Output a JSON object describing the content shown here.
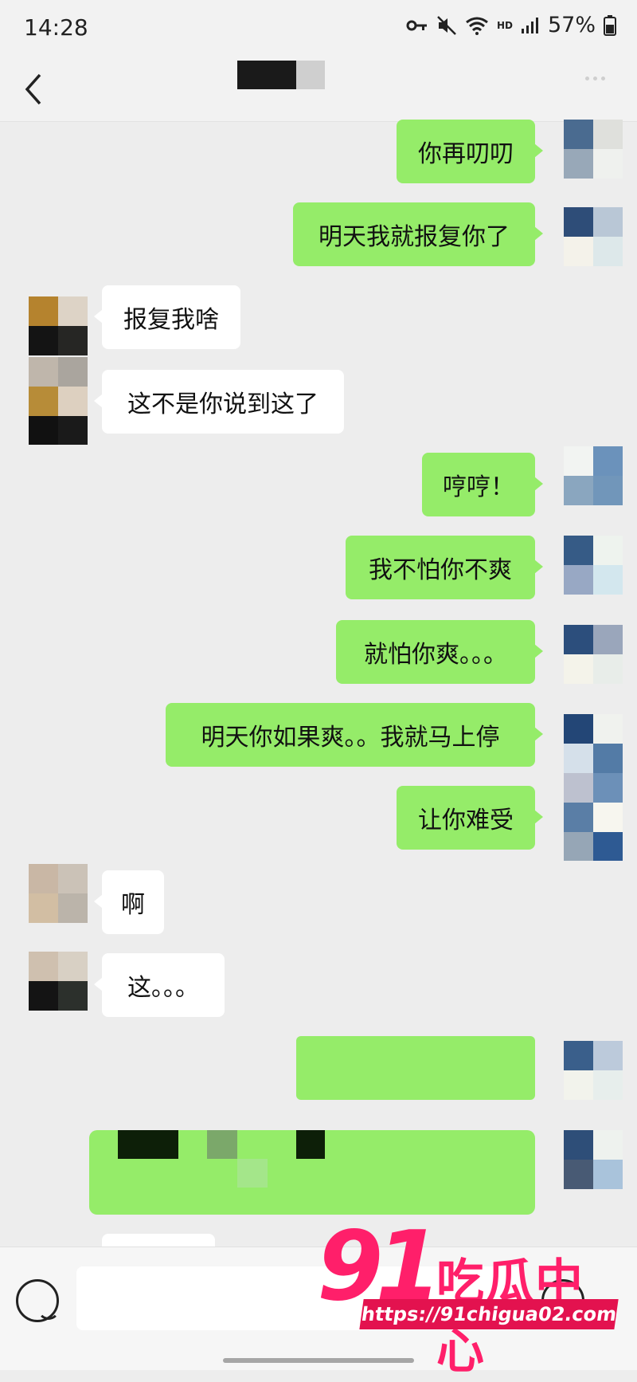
{
  "status_bar": {
    "time": "14:28",
    "hd": "HD",
    "battery": "57%"
  },
  "header": {
    "title_redacted": true
  },
  "messages": [
    {
      "side": "out",
      "text": "你再叨叨"
    },
    {
      "side": "out",
      "text": "明天我就报复你了"
    },
    {
      "side": "in",
      "text": "报复我啥"
    },
    {
      "side": "in",
      "text": "这不是你说到这了"
    },
    {
      "side": "out",
      "text": "哼哼！"
    },
    {
      "side": "out",
      "text": "我不怕你不爽"
    },
    {
      "side": "out",
      "text": "就怕你爽。。。"
    },
    {
      "side": "out",
      "text": "明天你如果爽。。我就马上停"
    },
    {
      "side": "out",
      "text": "让你难受"
    },
    {
      "side": "in",
      "text": "啊"
    },
    {
      "side": "in",
      "text": "这。。。"
    },
    {
      "side": "out",
      "text": "",
      "redacted": true
    },
    {
      "side": "out",
      "text": "",
      "redacted": true
    }
  ],
  "watermark": {
    "number": "91",
    "brand": "吃瓜中心",
    "url": "https://91chigua02.com"
  },
  "colors": {
    "outgoing_bubble": "#95ec69",
    "incoming_bubble": "#ffffff",
    "background": "#ededed",
    "watermark": "#ff1f6a"
  }
}
